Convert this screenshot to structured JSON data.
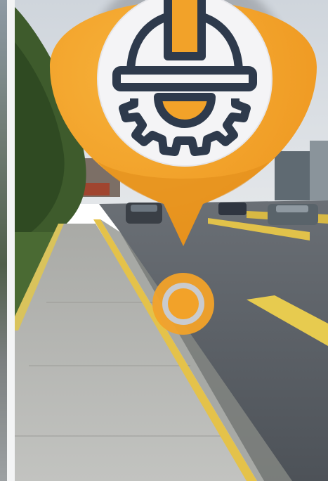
{
  "image": {
    "subject": "construction-location-pin-over-street",
    "colors": {
      "pin_orange": "#f2a229",
      "pin_shadow": "#e08c1a",
      "icon_navy": "#2e3a4c",
      "icon_badge": "#f4f4f6",
      "road": "#5f646b",
      "sidewalk": "#b7b9b7",
      "curb_yellow": "#e4c24a",
      "foliage": "#3e5b2c",
      "sky": "#d9dde2",
      "accent_band": "#2d6bb5"
    },
    "icons": [
      "hard-hat-icon",
      "gear-icon",
      "location-pin-icon",
      "target-marker-icon"
    ]
  }
}
